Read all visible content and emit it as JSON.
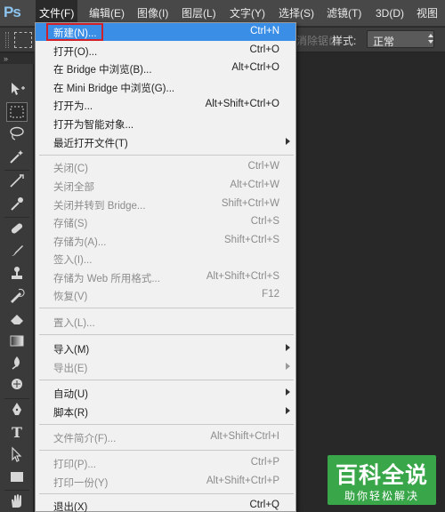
{
  "app": {
    "logo": "Ps"
  },
  "menubar": {
    "items": [
      "文件(F)",
      "编辑(E)",
      "图像(I)",
      "图层(L)",
      "文字(Y)",
      "选择(S)",
      "滤镜(T)",
      "3D(D)",
      "视图(V)"
    ]
  },
  "options_bar": {
    "ghost_text": "消除锯齿",
    "style_label": "样式:",
    "style_value": "正常"
  },
  "tools_panel": {
    "header": "»",
    "tools": [
      "move-tool",
      "marquee-tool",
      "lasso-tool",
      "magic-wand-tool",
      "crop-tool",
      "eyedropper-tool",
      "healing-brush-tool",
      "brush-tool",
      "clone-stamp-tool",
      "history-brush-tool",
      "eraser-tool",
      "gradient-tool",
      "blur-tool",
      "dodge-tool",
      "pen-tool",
      "type-tool",
      "path-selection-tool",
      "rectangle-tool",
      "hand-tool"
    ],
    "type_glyph": "T"
  },
  "file_menu": {
    "items": [
      {
        "label": "新建(N)...",
        "shortcut": "Ctrl+N",
        "enabled": true,
        "highlighted": true
      },
      {
        "label": "打开(O)...",
        "shortcut": "Ctrl+O",
        "enabled": true
      },
      {
        "label": "在 Bridge 中浏览(B)...",
        "shortcut": "Alt+Ctrl+O",
        "enabled": true
      },
      {
        "label": "在 Mini Bridge 中浏览(G)...",
        "shortcut": "",
        "enabled": true
      },
      {
        "label": "打开为...",
        "shortcut": "Alt+Shift+Ctrl+O",
        "enabled": true
      },
      {
        "label": "打开为智能对象...",
        "shortcut": "",
        "enabled": true
      },
      {
        "label": "最近打开文件(T)",
        "shortcut": "",
        "enabled": true,
        "submenu": true
      },
      {
        "label": "关闭(C)",
        "shortcut": "Ctrl+W",
        "enabled": false
      },
      {
        "label": "关闭全部",
        "shortcut": "Alt+Ctrl+W",
        "enabled": false
      },
      {
        "label": "关闭并转到 Bridge...",
        "shortcut": "Shift+Ctrl+W",
        "enabled": false
      },
      {
        "label": "存储(S)",
        "shortcut": "Ctrl+S",
        "enabled": false
      },
      {
        "label": "存储为(A)...",
        "shortcut": "Shift+Ctrl+S",
        "enabled": false
      },
      {
        "label": "签入(I)...",
        "shortcut": "",
        "enabled": false
      },
      {
        "label": "存储为 Web 所用格式...",
        "shortcut": "Alt+Shift+Ctrl+S",
        "enabled": false
      },
      {
        "label": "恢复(V)",
        "shortcut": "F12",
        "enabled": false
      },
      {
        "label": "置入(L)...",
        "shortcut": "",
        "enabled": false
      },
      {
        "label": "导入(M)",
        "shortcut": "",
        "enabled": true,
        "submenu": true
      },
      {
        "label": "导出(E)",
        "shortcut": "",
        "enabled": false,
        "submenu": true
      },
      {
        "label": "自动(U)",
        "shortcut": "",
        "enabled": true,
        "submenu": true
      },
      {
        "label": "脚本(R)",
        "shortcut": "",
        "enabled": true,
        "submenu": true
      },
      {
        "label": "文件简介(F)...",
        "shortcut": "Alt+Shift+Ctrl+I",
        "enabled": false
      },
      {
        "label": "打印(P)...",
        "shortcut": "Ctrl+P",
        "enabled": false
      },
      {
        "label": "打印一份(Y)",
        "shortcut": "Alt+Shift+Ctrl+P",
        "enabled": false
      },
      {
        "label": "退出(X)",
        "shortcut": "Ctrl+Q",
        "enabled": true
      }
    ]
  },
  "watermark": {
    "title": "百科全说",
    "subtitle": "助你轻松解决"
  },
  "colors": {
    "highlight": "#3a8ee6",
    "annotation_box": "#d0202a",
    "watermark_bg": "#39a64a",
    "logo": "#8bc4ee"
  }
}
